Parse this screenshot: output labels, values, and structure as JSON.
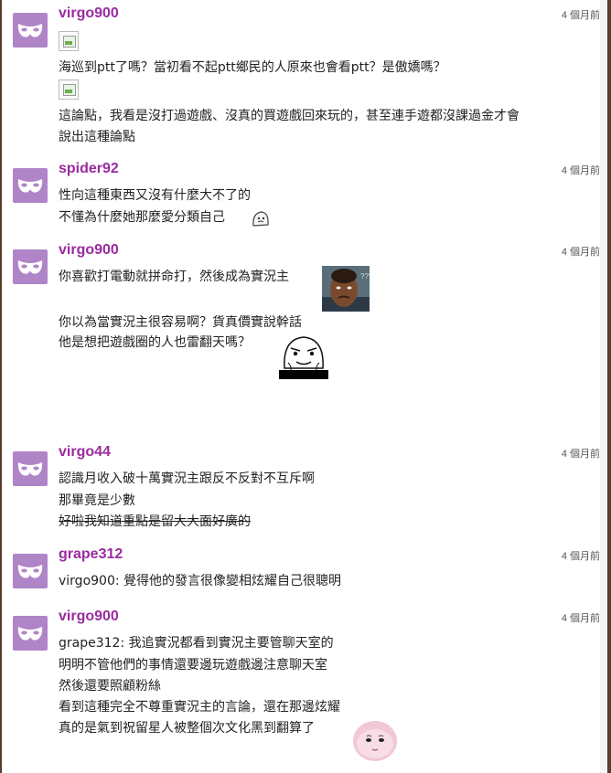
{
  "comments": [
    {
      "user": "virgo900",
      "time": "4 個月前",
      "lines": [
        "海巡到ptt了嗎？當初看不起ptt鄉民的人原來也會看ptt？是傲嬌嗎？",
        "這論點，我看是沒打過遊戲、沒真的買遊戲回來玩的，甚至連手遊都沒課過金才會",
        "說出這種論點"
      ]
    },
    {
      "user": "spider92",
      "time": "4 個月前",
      "lines": [
        "性向這種東西又沒有什麼大不了的",
        "不懂為什麼她那麼愛分類自己"
      ]
    },
    {
      "user": "virgo900",
      "time": "4 個月前",
      "lines": [
        "你喜歡打電動就拼命打，然後成為實況主",
        "你以為當實況主很容易啊？貨真價實說幹話",
        "他是想把遊戲圈的人也雷翻天嗎？"
      ],
      "sticker_text": "???"
    },
    {
      "user": "virgo44",
      "time": "4 個月前",
      "lines": [
        "認識月收入破十萬實況主跟反不反對不互斥啊",
        "那畢竟是少數",
        "好啦我知道重點是留大大面好廣的"
      ]
    },
    {
      "user": "grape312",
      "time": "4 個月前",
      "lines": [
        "virgo900: 覺得他的發言很像變相炫耀自己很聰明"
      ]
    },
    {
      "user": "virgo900",
      "time": "4 個月前",
      "lines": [
        "grape312: 我追實況都看到實況主要管聊天室的",
        "明明不管他們的事情還要邊玩遊戲邊注意聊天室",
        "然後還要照顧粉絲",
        "看到這種完全不尊重實況主的言論，還在那邊炫耀",
        "真的是氣到祝留星人被整個次文化黑到翻算了"
      ]
    }
  ],
  "icons": {
    "avatar": "masquerade-mask-icon",
    "broken_image": "broken-image-icon"
  },
  "colors": {
    "username": "#9b2aa0",
    "avatar_bg": "#b085c8",
    "frame": "#5a3b2c"
  }
}
